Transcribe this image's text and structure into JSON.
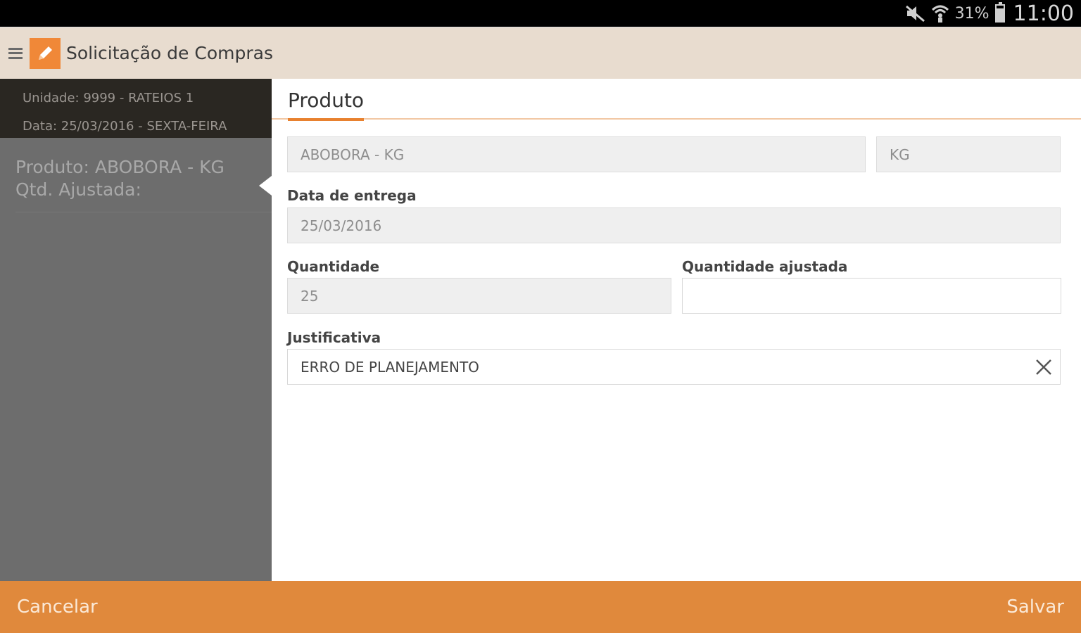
{
  "status_bar": {
    "battery_pct": "31%",
    "clock": "11:00",
    "icons": [
      "mute-icon",
      "wifi-icon",
      "battery-icon"
    ]
  },
  "app_bar": {
    "title": "Solicitação de Compras",
    "icons": [
      "menu-icon",
      "edit-icon"
    ]
  },
  "sidebar": {
    "unit": "Unidade: 9999 - RATEIOS 1",
    "date": "Data: 25/03/2016 - SEXTA-FEIRA",
    "items": [
      {
        "product": "Produto: ABOBORA - KG",
        "qty": "Qtd. Ajustada:"
      }
    ]
  },
  "form": {
    "tab": "Produto",
    "product_value": "ABOBORA - KG",
    "unit_value": "KG",
    "delivery_label": "Data de entrega",
    "delivery_value": "25/03/2016",
    "qty_label": "Quantidade",
    "qty_value": "25",
    "adj_qty_label": "Quantidade ajustada",
    "adj_qty_value": "",
    "justification_label": "Justificativa",
    "justification_value": "ERRO DE PLANEJAMENTO"
  },
  "bottom_bar": {
    "cancel": "Cancelar",
    "save": "Salvar"
  },
  "colors": {
    "accent": "#e0893c",
    "appbar": "#e8dccf",
    "sidebar": "#6d6d6d",
    "sidebar_header": "#2a2722"
  }
}
